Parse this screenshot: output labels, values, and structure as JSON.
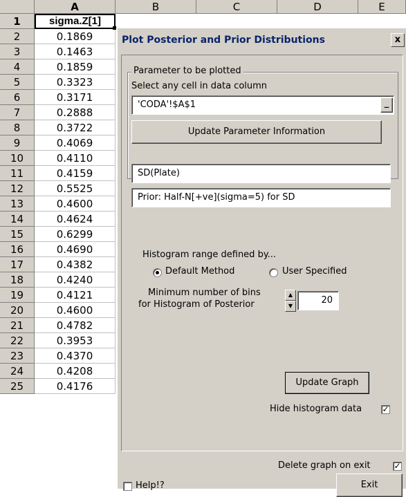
{
  "sheet": {
    "columns": [
      "A",
      "B",
      "C",
      "D",
      "E"
    ],
    "rows": [
      {
        "num": "1",
        "value": "sigma.Z[1]"
      },
      {
        "num": "2",
        "value": "0.1869"
      },
      {
        "num": "3",
        "value": "0.1463"
      },
      {
        "num": "4",
        "value": "0.1859"
      },
      {
        "num": "5",
        "value": "0.3323"
      },
      {
        "num": "6",
        "value": "0.3171"
      },
      {
        "num": "7",
        "value": "0.2888"
      },
      {
        "num": "8",
        "value": "0.3722"
      },
      {
        "num": "9",
        "value": "0.4069"
      },
      {
        "num": "10",
        "value": "0.4110"
      },
      {
        "num": "11",
        "value": "0.4159"
      },
      {
        "num": "12",
        "value": "0.5525"
      },
      {
        "num": "13",
        "value": "0.4600"
      },
      {
        "num": "14",
        "value": "0.4624"
      },
      {
        "num": "15",
        "value": "0.6299"
      },
      {
        "num": "16",
        "value": "0.4690"
      },
      {
        "num": "17",
        "value": "0.4382"
      },
      {
        "num": "18",
        "value": "0.4240"
      },
      {
        "num": "19",
        "value": "0.4121"
      },
      {
        "num": "20",
        "value": "0.4600"
      },
      {
        "num": "21",
        "value": "0.4782"
      },
      {
        "num": "22",
        "value": "0.3953"
      },
      {
        "num": "23",
        "value": "0.4370"
      },
      {
        "num": "24",
        "value": "0.4208"
      },
      {
        "num": "25",
        "value": "0.4176"
      }
    ]
  },
  "dialog": {
    "title": "Plot Posterior and Prior Distributions",
    "close_label": "x",
    "group_caption": "Parameter to be plotted",
    "select_label": "Select any cell in data column",
    "cell_ref": "'CODA'!$A$1",
    "ref_button": "_",
    "update_param_button": "Update Parameter Information",
    "param_name": "SD(Plate)",
    "prior_desc": "Prior: Half-N[+ve](sigma=5) for SD",
    "histogram_label": "Histogram range defined by...",
    "radio_default": "Default Method",
    "radio_user": "User Specified",
    "radio_selected": "default",
    "bins_label_line1": "Minimum number of bins",
    "bins_label_line2": "for Histogram of Posterior",
    "bins_value": "20",
    "update_graph_button": "Update Graph",
    "hide_histogram_label": "Hide histogram data",
    "hide_histogram_checked": true,
    "delete_graph_label": "Delete graph on exit",
    "delete_graph_checked": true,
    "help_label": "Help!?",
    "help_checked": false,
    "exit_button": "Exit"
  },
  "colors": {
    "dialog_bg": "#d4d0c8",
    "title_text": "#0a246a",
    "header_bg": "#d4d0c8"
  }
}
